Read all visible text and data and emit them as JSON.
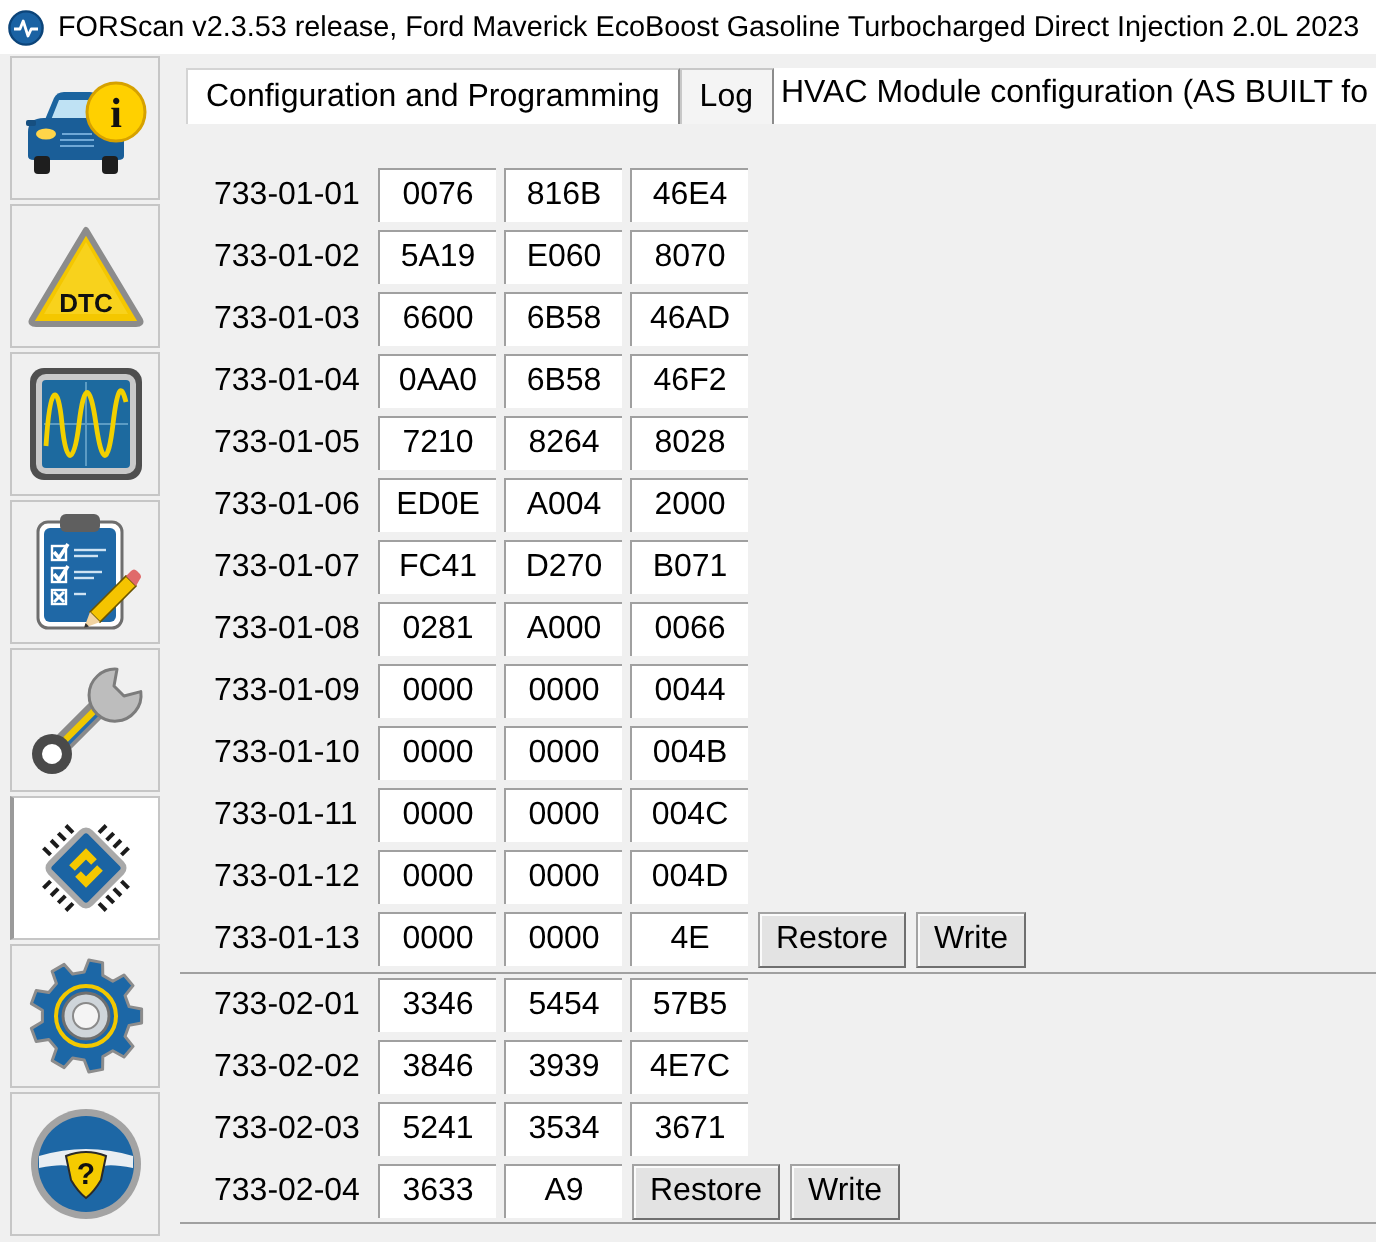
{
  "window": {
    "title": "FORScan v2.3.53 release, Ford Maverick EcoBoost Gasoline Turbocharged Direct Injection 2.0L 2023"
  },
  "sidebar": {
    "items": [
      {
        "kind": "vehicle",
        "glyph": "i",
        "selected": false
      },
      {
        "kind": "dtc",
        "glyph": "DTC",
        "selected": false
      },
      {
        "kind": "scope",
        "selected": false
      },
      {
        "kind": "checklist",
        "selected": false
      },
      {
        "kind": "service",
        "selected": false
      },
      {
        "kind": "config",
        "selected": true
      },
      {
        "kind": "settings",
        "selected": false
      },
      {
        "kind": "help",
        "glyph": "?",
        "selected": false
      }
    ]
  },
  "tabs": [
    {
      "label": "Configuration and Programming",
      "selected": true
    },
    {
      "label": "Log",
      "selected": false
    }
  ],
  "panel_title": "HVAC Module configuration (AS BUILT fo",
  "blocks": [
    {
      "rows": [
        {
          "address": "733-01-01",
          "values": [
            "0076",
            "816B",
            "46E4"
          ]
        },
        {
          "address": "733-01-02",
          "values": [
            "5A19",
            "E060",
            "8070"
          ]
        },
        {
          "address": "733-01-03",
          "values": [
            "6600",
            "6B58",
            "46AD"
          ]
        },
        {
          "address": "733-01-04",
          "values": [
            "0AA0",
            "6B58",
            "46F2"
          ]
        },
        {
          "address": "733-01-05",
          "values": [
            "7210",
            "8264",
            "8028"
          ]
        },
        {
          "address": "733-01-06",
          "values": [
            "ED0E",
            "A004",
            "2000"
          ]
        },
        {
          "address": "733-01-07",
          "values": [
            "FC41",
            "D270",
            "B071"
          ]
        },
        {
          "address": "733-01-08",
          "values": [
            "0281",
            "A000",
            "0066"
          ]
        },
        {
          "address": "733-01-09",
          "values": [
            "0000",
            "0000",
            "0044"
          ]
        },
        {
          "address": "733-01-10",
          "values": [
            "0000",
            "0000",
            "004B"
          ]
        },
        {
          "address": "733-01-11",
          "values": [
            "0000",
            "0000",
            "004C"
          ]
        },
        {
          "address": "733-01-12",
          "values": [
            "0000",
            "0000",
            "004D"
          ]
        },
        {
          "address": "733-01-13",
          "values": [
            "0000",
            "0000",
            "4E"
          ],
          "buttons": [
            "Restore",
            "Write"
          ]
        }
      ]
    },
    {
      "rows": [
        {
          "address": "733-02-01",
          "values": [
            "3346",
            "5454",
            "57B5"
          ]
        },
        {
          "address": "733-02-02",
          "values": [
            "3846",
            "3939",
            "4E7C"
          ]
        },
        {
          "address": "733-02-03",
          "values": [
            "5241",
            "3534",
            "3671"
          ]
        },
        {
          "address": "733-02-04",
          "values": [
            "3633",
            "A9"
          ],
          "buttons": [
            "Restore",
            "Write"
          ]
        }
      ]
    }
  ]
}
